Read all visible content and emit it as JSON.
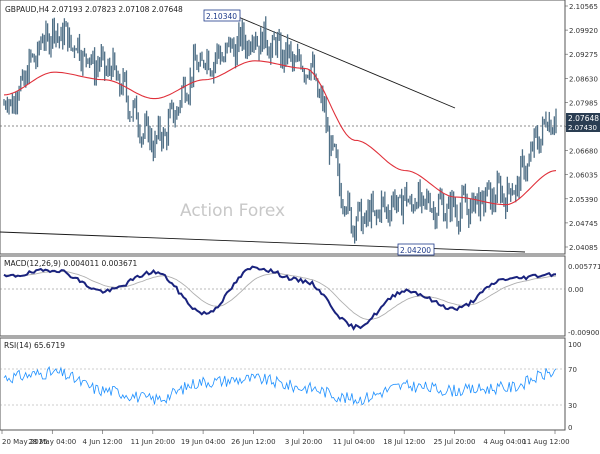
{
  "header": {
    "symbol_info": "GBPAUD,H4  2.07193 2.07823 2.07108 2.07648"
  },
  "main_panel": {
    "watermark": "Action Forex",
    "price_axis_labels": [
      "2.10565",
      "2.09920",
      "2.09275",
      "2.08630",
      "2.07985",
      "2.07335",
      "2.06680",
      "2.06035",
      "2.05390",
      "2.04745",
      "2.04085"
    ],
    "current_price_tag": "2.07648",
    "dotted_level_tag": "2.07430",
    "high_label": "2.10340",
    "low_label": "2.04200",
    "colors": {
      "price_line": "#4f6f86",
      "moving_average": "#e0303a",
      "trendline": "#1a1a1a",
      "tag_background": "#2a3d52",
      "label_border": "#1e3a8a"
    }
  },
  "macd_panel": {
    "title": "MACD(12,26,9) 0.004011 0.003671",
    "scale_labels": [
      "0.005771",
      "0.00",
      "-0.009001"
    ],
    "colors": {
      "macd": "#1a237e",
      "signal": "#b0b0b0"
    }
  },
  "rsi_panel": {
    "title": "RSI(14) 65.6719",
    "scale_labels": [
      "100",
      "70",
      "30",
      "0"
    ],
    "colors": {
      "rsi": "#1e90ff",
      "levels": "#9a9a9a"
    }
  },
  "time_axis": {
    "labels": [
      "20 May 2025",
      "28 May 04:00",
      "4 Jun 12:00",
      "11 Jun 20:00",
      "19 Jun 04:00",
      "26 Jun 12:00",
      "3 Jul 20:00",
      "11 Jul 04:00",
      "18 Jul 12:00",
      "25 Jul 20:00",
      "4 Aug 04:00",
      "11 Aug 12:00"
    ]
  },
  "chart_data": {
    "type": "line",
    "title": "",
    "x": [
      "20 May 2025",
      "28 May 04:00",
      "4 Jun 12:00",
      "11 Jun 20:00",
      "19 Jun 04:00",
      "26 Jun 12:00",
      "3 Jul 20:00",
      "11 Jul 04:00",
      "18 Jul 12:00",
      "25 Jul 20:00",
      "4 Aug 04:00",
      "11 Aug 12:00"
    ],
    "series": [
      {
        "name": "",
        "values": [
          2.0795,
          2.0985,
          2.0895,
          2.07,
          2.091,
          2.097,
          2.09,
          2.049,
          2.054,
          2.052,
          2.056,
          2.0765
        ]
      },
      {
        "name": "",
        "values": [
          2.082,
          2.088,
          2.086,
          2.081,
          2.086,
          2.091,
          2.089,
          2.07,
          2.062,
          2.055,
          2.053,
          2.062
        ]
      }
    ],
    "ylim": [
      2.0405,
      2.106
    ],
    "grid": false,
    "legend": "none",
    "annotations": {
      "high": "2.10340",
      "low": "2.04200",
      "last": "2.07648",
      "level": "2.07430"
    },
    "macd": {
      "title": "MACD(12,26,9) 0.004011 0.003671",
      "ylim": [
        -0.0095,
        0.0062
      ],
      "values": [
        0.003,
        0.0045,
        -0.0002,
        0.004,
        -0.005,
        0.005,
        0.002,
        -0.008,
        0.0,
        -0.004,
        0.0025,
        0.0036
      ]
    },
    "rsi": {
      "title": "RSI(14) 65.6719",
      "ylim": [
        0,
        100
      ],
      "levels": [
        70,
        30
      ],
      "values": [
        60,
        65,
        45,
        35,
        55,
        58,
        48,
        35,
        50,
        45,
        48,
        65.67
      ]
    }
  }
}
